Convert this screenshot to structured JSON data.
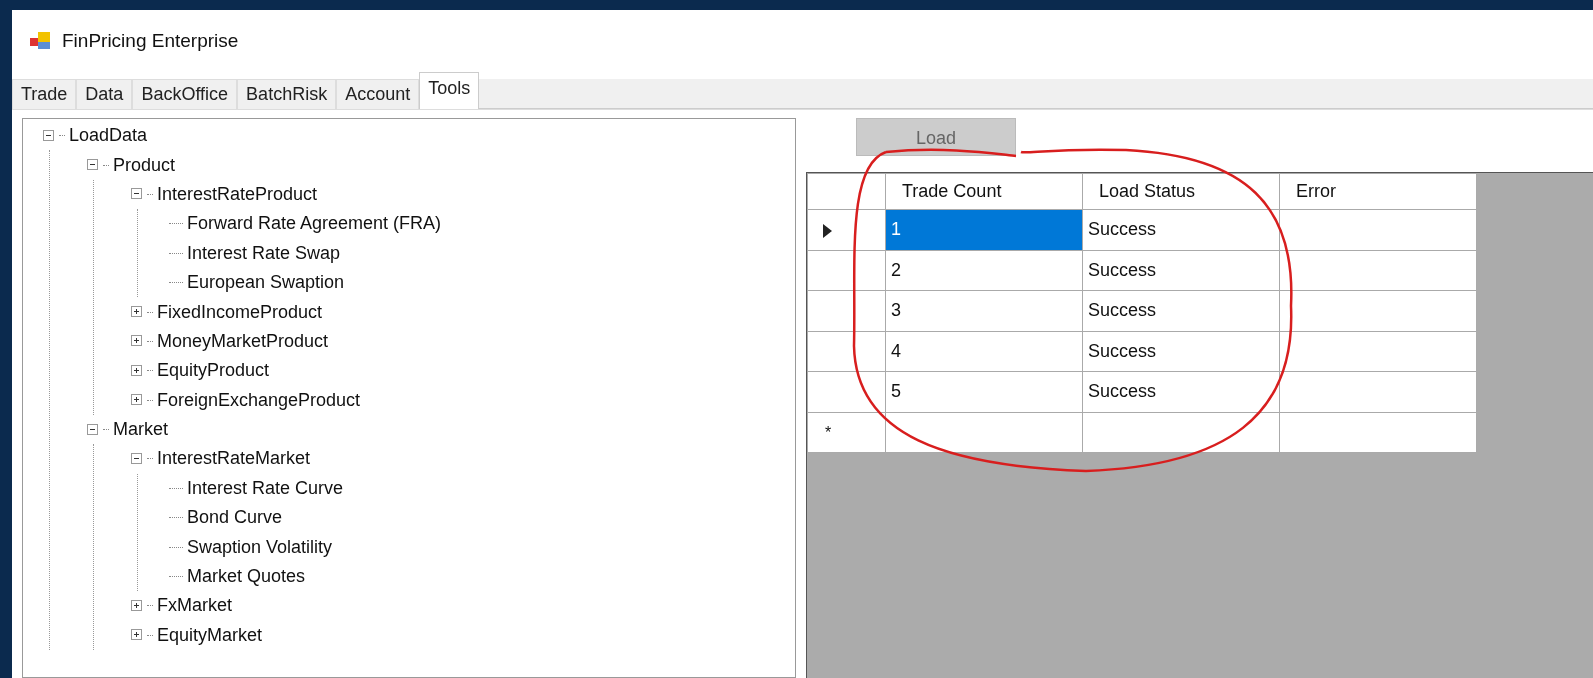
{
  "window": {
    "title": "FinPricing Enterprise"
  },
  "tabs": [
    {
      "label": "Trade",
      "selected": false
    },
    {
      "label": "Data",
      "selected": false
    },
    {
      "label": "BackOffice",
      "selected": false
    },
    {
      "label": "BatchRisk",
      "selected": false
    },
    {
      "label": "Account",
      "selected": false
    },
    {
      "label": "Tools",
      "selected": true
    }
  ],
  "tree": [
    {
      "label": "LoadData",
      "expanded": true,
      "children": [
        {
          "label": "Product",
          "expanded": true,
          "children": [
            {
              "label": "InterestRateProduct",
              "expanded": true,
              "children": [
                {
                  "label": "Forward Rate Agreement (FRA)"
                },
                {
                  "label": "Interest Rate Swap"
                },
                {
                  "label": "European Swaption"
                }
              ]
            },
            {
              "label": "FixedIncomeProduct",
              "expanded": false
            },
            {
              "label": "MoneyMarketProduct",
              "expanded": false
            },
            {
              "label": "EquityProduct",
              "expanded": false
            },
            {
              "label": "ForeignExchangeProduct",
              "expanded": false
            }
          ]
        },
        {
          "label": "Market",
          "expanded": true,
          "children": [
            {
              "label": "InterestRateMarket",
              "expanded": true,
              "children": [
                {
                  "label": "Interest Rate Curve"
                },
                {
                  "label": "Bond Curve"
                },
                {
                  "label": "Swaption Volatility"
                },
                {
                  "label": "Market Quotes"
                }
              ]
            },
            {
              "label": "FxMarket",
              "expanded": false
            },
            {
              "label": "EquityMarket",
              "expanded": false
            }
          ]
        }
      ]
    }
  ],
  "load_button": {
    "label": "Load",
    "disabled": true
  },
  "grid": {
    "columns": [
      "Trade Count",
      "Load Status",
      "Error"
    ],
    "rows": [
      {
        "trade_count": "1",
        "load_status": "Success",
        "selected": true
      },
      {
        "trade_count": "2",
        "load_status": "Success",
        "selected": false
      },
      {
        "trade_count": "3",
        "load_status": "Success",
        "selected": false
      },
      {
        "trade_count": "4",
        "load_status": "Success",
        "selected": false
      },
      {
        "trade_count": "5",
        "load_status": "Success",
        "selected": false
      }
    ],
    "new_row_marker": "*"
  }
}
